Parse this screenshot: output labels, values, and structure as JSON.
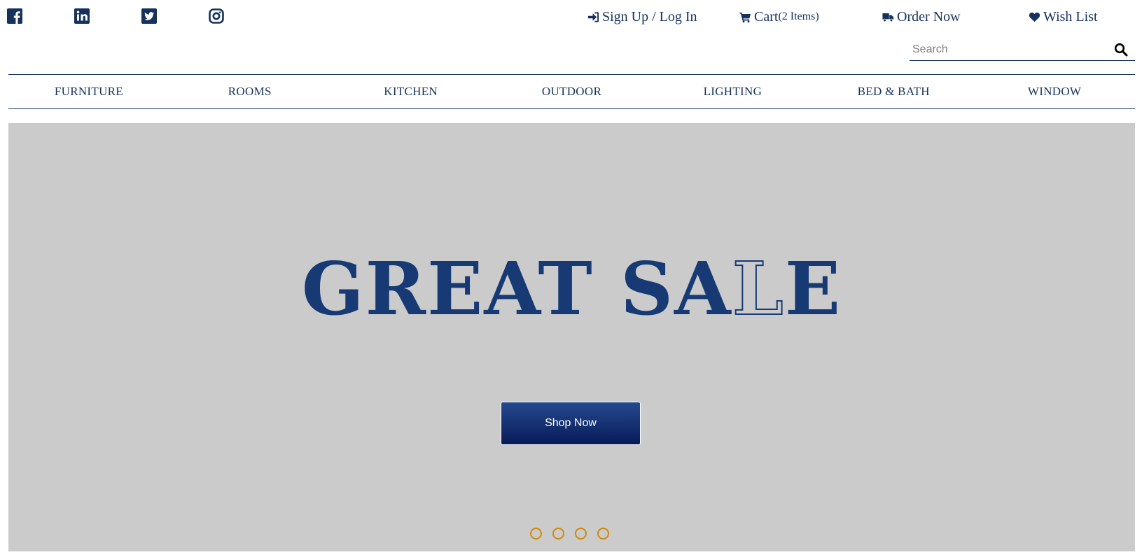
{
  "social": {
    "facebook": "facebook-icon",
    "linkedin": "linkedin-icon",
    "twitter": "twitter-icon",
    "instagram": "instagram-icon"
  },
  "topnav": {
    "signup": {
      "icon": "sign-in-icon",
      "label": "Sign Up / Log In"
    },
    "cart": {
      "icon": "cart-icon",
      "label": "Cart",
      "count": "(2 Items)"
    },
    "order": {
      "icon": "truck-icon",
      "label": "Order Now"
    },
    "wishlist": {
      "icon": "heart-icon",
      "label": "Wish List"
    }
  },
  "search": {
    "placeholder": "Search",
    "value": "",
    "icon": "search-icon"
  },
  "nav": {
    "items": [
      "FURNITURE",
      "ROOMS",
      "KITCHEN",
      "OUTDOOR",
      "LIGHTING",
      "BED & BATH",
      "WINDOW"
    ]
  },
  "hero": {
    "title_part1": "GREAT SA",
    "title_outline": "L",
    "title_part2": "E",
    "button_label": "Shop Now",
    "slide_count": 4
  },
  "colors": {
    "primary": "#16325c",
    "hero_title": "#173a75",
    "hero_bg": "#cbcbcb",
    "button_top": "#254a8f",
    "button_bottom": "#071a58",
    "dot_accent": "#cf8a0c"
  }
}
